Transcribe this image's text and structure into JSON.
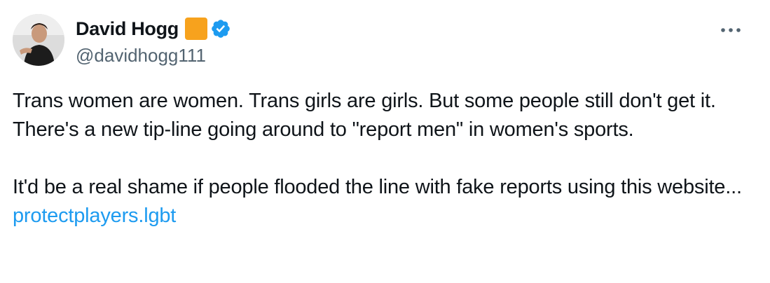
{
  "author": {
    "display_name": "David Hogg",
    "handle": "@davidhogg111",
    "affiliate_badge_color": "#f7a21d",
    "verified_badge_color": "#1d9bf0",
    "avatar_icon": "profile-photo"
  },
  "menu": {
    "more_icon": "ellipsis-icon",
    "more_label": "···"
  },
  "tweet": {
    "paragraph1": "Trans women are women. Trans girls are girls. But some people still don't get it. There's a new tip-line going around to \"report men\" in women's sports.",
    "paragraph2_text": "It'd be a real shame if people flooded the line with fake reports using this website... ",
    "link_text": "protectplayers.lgbt",
    "link_color": "#1d9bf0"
  },
  "colors": {
    "text_primary": "#0f1419",
    "text_secondary": "#536471",
    "background": "#ffffff"
  }
}
